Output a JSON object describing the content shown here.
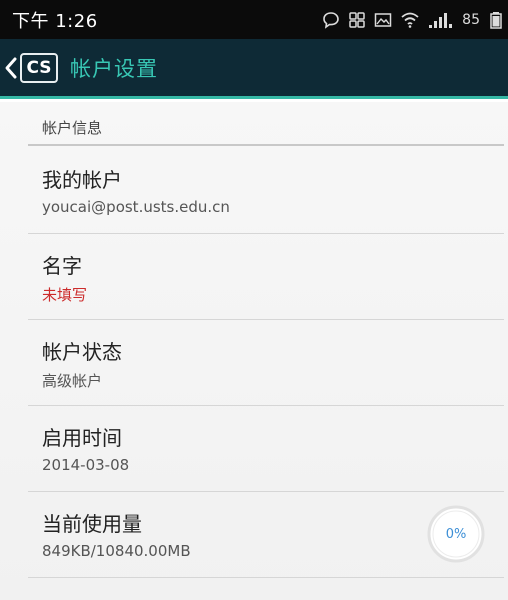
{
  "status_bar": {
    "time": "下午 1:26",
    "battery": "85"
  },
  "action_bar": {
    "logo_text": "CS",
    "title": "帐户设置",
    "title_color": "#38c7b4",
    "background": "#0e2a36"
  },
  "section": {
    "header": "帐户信息"
  },
  "rows": [
    {
      "title": "我的帐户",
      "value": "youcai@post.usts.edu.cn"
    },
    {
      "title": "名字",
      "value": "未填写",
      "value_color": "#cc2b2b"
    },
    {
      "title": "帐户状态",
      "value": "高级帐户"
    },
    {
      "title": "启用时间",
      "value": "2014-03-08"
    },
    {
      "title": "当前使用量",
      "value": "849KB/10840.00MB"
    }
  ],
  "usage": {
    "percent_label": "0%",
    "percent": 0
  }
}
